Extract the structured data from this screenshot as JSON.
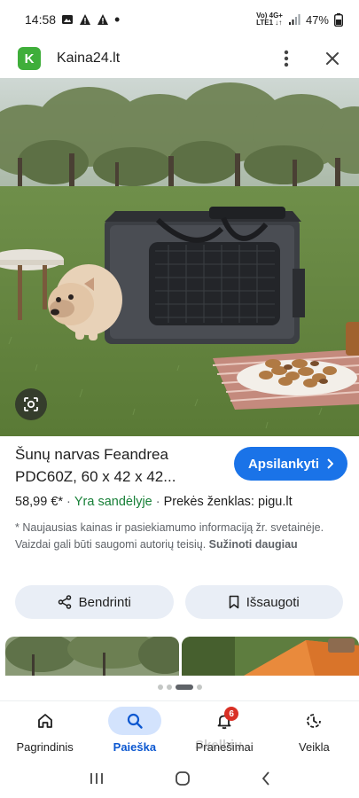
{
  "status_bar": {
    "time": "14:58",
    "network_top": "Vo) 4G+",
    "network_bottom": "LTE1 ↓↑",
    "battery": "47%"
  },
  "app_bar": {
    "logo_letter": "K",
    "title": "Kaina24.lt",
    "logo_color": "#3fae3a"
  },
  "product": {
    "title": "Šunų narvas Feandrea PDC60Z, 60 x 42 x 42...",
    "visit_label": "Apsilankyti",
    "price": "58,99 €*",
    "availability": "Yra sandėlyje",
    "brand": "Prekės ženklas: pigu.lt",
    "disclaimer": "* Naujausias kainas ir pasiekiamumo informaciją žr. svetainėje. Vaizdai gali būti saugomi autorių teisių.",
    "learn_more": "Sužinoti daugiau"
  },
  "actions": {
    "share_label": "Bendrinti",
    "save_label": "Išsaugoti"
  },
  "bottom_nav": [
    {
      "label": "Pagrindinis",
      "icon": "home-icon"
    },
    {
      "label": "Paieška",
      "icon": "search-icon",
      "active": true
    },
    {
      "label": "Pranešimai",
      "icon": "bell-icon",
      "badge": "6"
    },
    {
      "label": "Veikla",
      "icon": "activity-icon"
    }
  ],
  "watermark": "Skelbiu",
  "colors": {
    "accent": "#1a73e8",
    "active_nav": "#0b57d0",
    "instock": "#188038",
    "badge": "#d93025"
  }
}
